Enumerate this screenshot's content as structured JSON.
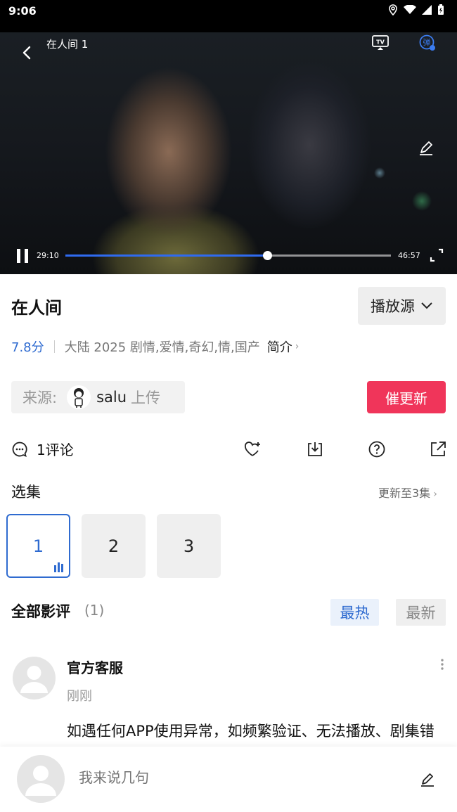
{
  "status_bar": {
    "time": "9:06"
  },
  "player": {
    "title": "在人间 1",
    "current_time": "29:10",
    "duration": "46:57",
    "progress": 0.62,
    "tv_label": "TV",
    "danmu_label": "弹"
  },
  "show": {
    "title": "在人间",
    "source_button": "播放源",
    "score": "7.8分",
    "info": "大陆  2025  剧情,爱情,奇幻,情,国产",
    "intro_link": "简介"
  },
  "uploader": {
    "label": "来源:",
    "name": "salu",
    "suffix": "上传"
  },
  "urge_button": "催更新",
  "actions": {
    "comment_label": "1评论"
  },
  "episodes": {
    "heading": "选集",
    "update_text": "更新至3集",
    "items": [
      "1",
      "2",
      "3"
    ],
    "active_index": 0
  },
  "reviews": {
    "heading": "全部影评",
    "count": "(1)",
    "tab_hot": "最热",
    "tab_new": "最新",
    "items": [
      {
        "author": "官方客服",
        "time": "刚刚",
        "text": "如遇任何APP使用异常，如频繁验证、无法播放、剧集错乱等，请先尝试重启，如还无法解决，请达"
      }
    ]
  },
  "composer": {
    "placeholder": "我来说几句"
  }
}
